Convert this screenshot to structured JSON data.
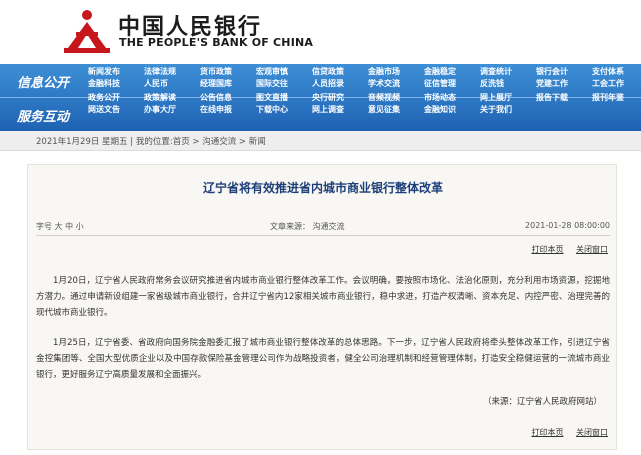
{
  "header": {
    "bank_name_cn": "中国人民银行",
    "bank_name_en": "THE PEOPLE'S BANK OF CHINA",
    "logo_icon": "pboc-logo-icon",
    "colors": {
      "brand_red": "#c8161d",
      "nav_blue": "#2a74c4",
      "title_blue": "#1d3f7a"
    }
  },
  "nav": {
    "section1_title": "信息公开",
    "section2_title": "服务互动",
    "row1": [
      "新闻发布",
      "法律法规",
      "货币政策",
      "宏观审慎",
      "信贷政策",
      "金融市场",
      "金融稳定",
      "调查统计",
      "银行会计",
      "支付体系"
    ],
    "row2": [
      "金融科技",
      "人民币",
      "经理国库",
      "国际交往",
      "人员招录",
      "学术交流",
      "征信管理",
      "反洗钱",
      "党建工作",
      "工会工作"
    ],
    "row3": [
      "政务公开",
      "政策解读",
      "公告信息",
      "图文直播",
      "央行研究",
      "音频视频",
      "市场动态",
      "网上展厅",
      "报告下载",
      "报刊年鉴"
    ],
    "row4": [
      "网送文告",
      "办事大厅",
      "在线申报",
      "下载中心",
      "网上调查",
      "意见征集",
      "金融知识",
      "关于我们"
    ]
  },
  "crumb": {
    "text": "2021年1月29日 星期五 | 我的位置:首页 > 沟通交流 > 新闻"
  },
  "article": {
    "title": "辽宁省将有效推进省内城市商业银行整体改革",
    "font_size_label": "字号 大 中 小",
    "source_label": "文章来源：  沟通交流",
    "datetime": "2021-01-28 08:00:00",
    "print_label": "打印本页",
    "close_label": "关闭窗口",
    "para1": "1月20日，辽宁省人民政府常务会议研究推进省内城市商业银行整体改革工作。会议明确，要按照市场化、法治化原则，充分利用市场资源，挖掘地方潜力。通过申请新设组建一家省级城市商业银行，合并辽宁省内12家相关城市商业银行，稳中求进，打造产权清晰、资本充足、内控严密、治理完善的现代城市商业银行。",
    "para2": "1月25日，辽宁省委、省政府向国务院金融委汇报了城市商业银行整体改革的总体思路。下一步，辽宁省人民政府将牵头整体改革工作，引进辽宁省金控集团等、全国大型优质企业以及中国存款保险基金管理公司作为战略投资者，健全公司治理机制和经营管理体制，打造安全稳健运营的一流城市商业银行，更好服务辽宁高质量发展和全面振兴。",
    "source_note": "（来源：辽宁省人民政府网站）"
  }
}
